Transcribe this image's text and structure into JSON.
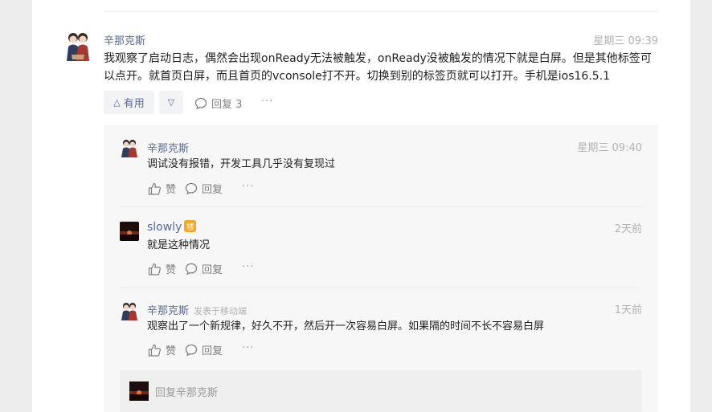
{
  "post": {
    "author": "辛那克斯",
    "time": "星期三 09:39",
    "content": "我观察了启动日志，偶然会出现onReady无法被触发，onReady没被触发的情况下就是白屏。但是其他标签可以点开。就首页白屏，而且首页的vconsole打不开。切换到别的标签页就可以打开。手机是ios16.5.1",
    "useful_label": "有用",
    "reply_label": "回复 3",
    "more": "···"
  },
  "replies": [
    {
      "author": "辛那克斯",
      "time": "星期三 09:40",
      "content": "调试没有报错，开发工具几乎没有复现过",
      "like_label": "赞",
      "reply_label": "回复",
      "more": "···"
    },
    {
      "author": "slowly",
      "badge": "楼",
      "time": "2天前",
      "content": "就是这种情况",
      "like_label": "赞",
      "reply_label": "回复",
      "more": "···"
    },
    {
      "author": "辛那克斯",
      "source": "发表于移动端",
      "time": "1天前",
      "content": "观察出了一个新规律，好久不开，然后开一次容易白屏。如果隔的时间不长不容易白屏",
      "like_label": "赞",
      "reply_label": "回复",
      "more": "···"
    }
  ],
  "reply_input": {
    "placeholder": "回复辛那克斯"
  },
  "colors": {
    "link": "#576b95",
    "badge": "#f5a623",
    "muted": "#b2b2b2"
  },
  "icons": [
    "avatar-illustration",
    "sunset-avatar",
    "thumbs-up-icon",
    "comment-icon",
    "triangle-up-icon",
    "triangle-down-icon"
  ]
}
